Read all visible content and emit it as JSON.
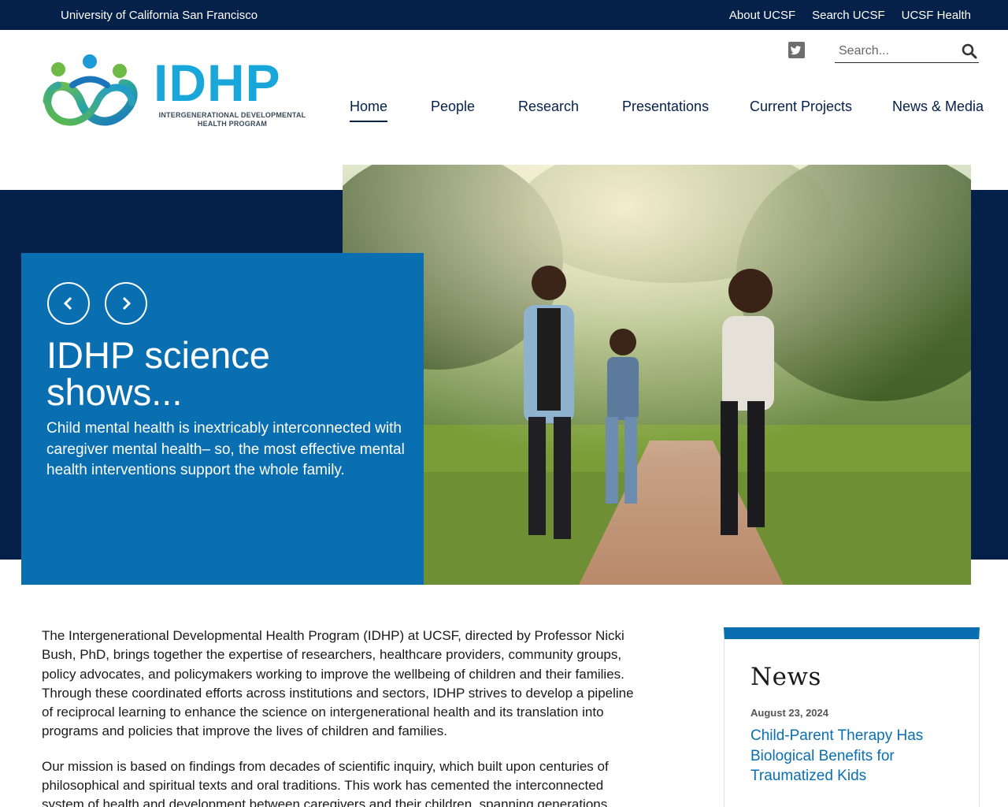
{
  "topbar": {
    "university": "University of California San Francisco",
    "links": [
      "About UCSF",
      "Search UCSF",
      "UCSF Health"
    ]
  },
  "logo": {
    "wordmark": "IDHP",
    "tagline_line1": "INTERGENERATIONAL DEVELOPMENTAL",
    "tagline_line2": "HEALTH PROGRAM"
  },
  "header": {
    "social_icon": "twitter-icon",
    "search_placeholder": "Search...",
    "search_icon": "search-icon"
  },
  "nav": {
    "items": [
      "Home",
      "People",
      "Research",
      "Presentations",
      "Current Projects",
      "News & Media"
    ],
    "active": "Home"
  },
  "hero": {
    "title": "IDHP science shows...",
    "text": "Child mental health is inextricably interconnected with caregiver mental health– so, the most effective mental health interventions support the whole family.",
    "prev_icon": "chevron-left-icon",
    "next_icon": "chevron-right-icon"
  },
  "content": {
    "paragraph1": "The Intergenerational Developmental Health Program (IDHP) at UCSF, directed by Professor Nicki Bush, PhD, brings together the expertise of researchers, healthcare providers, community groups, policy advocates, and policymakers working to improve the wellbeing of children and their families. Through these coordinated efforts across institutions and sectors, IDHP strives to develop a pipeline of reciprocal learning to enhance the science on intergenerational health and its translation into programs and policies that improve the lives of children and families.",
    "paragraph2": "Our mission is based on findings from decades of scientific inquiry, which built upon centuries of philosophical and spiritual texts and oral traditions. This work has cemented the interconnected system of health and development between caregivers and their children, spanning generations."
  },
  "news": {
    "heading": "News",
    "date": "August 23, 2024",
    "headline": "Child-Parent Therapy Has Biological Benefits for Traumatized Kids"
  },
  "colors": {
    "navy": "#052049",
    "blue": "#0a6fb1",
    "logo_cyan": "#18a7d8"
  }
}
